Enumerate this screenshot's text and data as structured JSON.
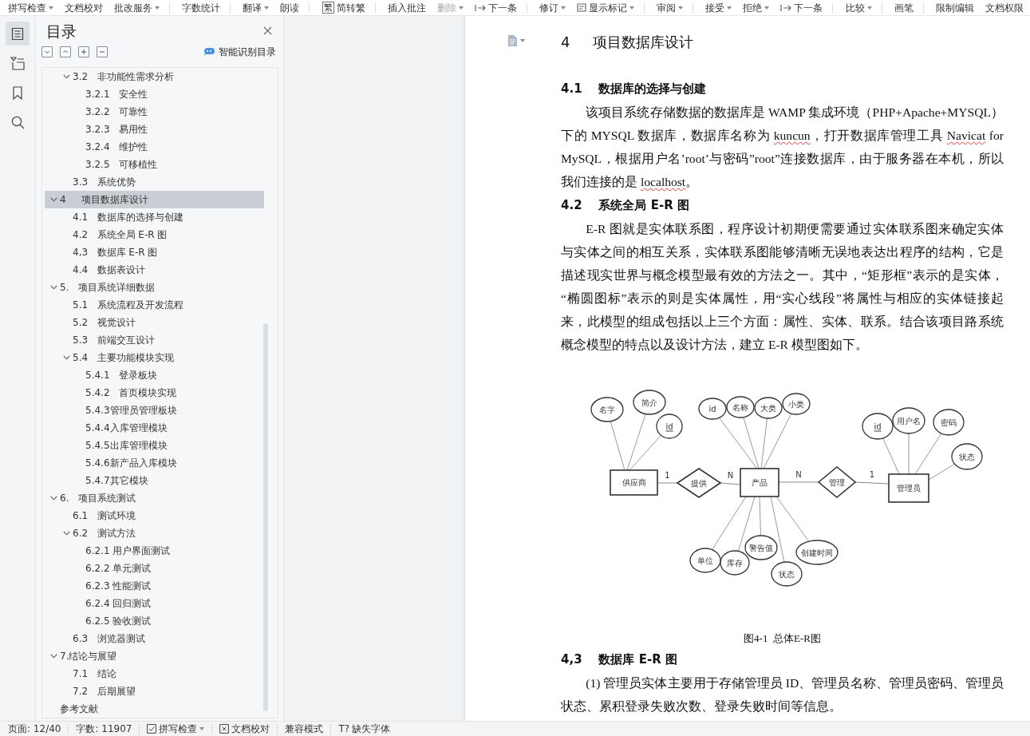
{
  "toolbar": {
    "groups": [
      [
        {
          "label": "拼写检查",
          "kind": "plain",
          "dropdown": true,
          "disabled": false
        },
        {
          "label": "文档校对",
          "kind": "plain",
          "dropdown": false,
          "disabled": false
        },
        {
          "label": "批改服务",
          "kind": "plain",
          "dropdown": true,
          "disabled": false
        }
      ],
      [
        {
          "label": "字数统计",
          "kind": "plain",
          "dropdown": false,
          "disabled": false
        }
      ],
      [
        {
          "label": "翻译",
          "kind": "plain",
          "dropdown": true,
          "disabled": false
        },
        {
          "label": "朗读",
          "kind": "plain",
          "dropdown": false,
          "disabled": false
        }
      ],
      [
        {
          "label": "简转繁",
          "kind": "glyph",
          "icon_text": "繁",
          "dropdown": false,
          "disabled": false
        }
      ],
      [
        {
          "label": "插入批注",
          "kind": "plain",
          "dropdown": false,
          "disabled": false
        },
        {
          "label": "删除",
          "kind": "plain",
          "dropdown": true,
          "disabled": true
        },
        {
          "label": "下一条",
          "kind": "next",
          "dropdown": false,
          "disabled": false
        }
      ],
      [
        {
          "label": "修订",
          "kind": "plain",
          "dropdown": true,
          "disabled": false
        },
        {
          "label": "显示标记",
          "kind": "markup",
          "dropdown": true,
          "disabled": false
        }
      ],
      [
        {
          "label": "审阅",
          "kind": "plain",
          "dropdown": true,
          "disabled": false
        }
      ],
      [
        {
          "label": "接受",
          "kind": "plain",
          "dropdown": true,
          "disabled": false
        },
        {
          "label": "拒绝",
          "kind": "plain",
          "dropdown": true,
          "disabled": false
        },
        {
          "label": "下一条",
          "kind": "next",
          "dropdown": false,
          "disabled": false
        }
      ],
      [
        {
          "label": "比较",
          "kind": "plain",
          "dropdown": true,
          "disabled": false
        }
      ],
      [
        {
          "label": "画笔",
          "kind": "plain",
          "dropdown": false,
          "disabled": false
        }
      ],
      [
        {
          "label": "限制编辑",
          "kind": "plain",
          "dropdown": false,
          "disabled": false
        },
        {
          "label": "文档权限",
          "kind": "plain",
          "dropdown": false,
          "disabled": false
        }
      ]
    ]
  },
  "rail": {
    "items": [
      {
        "kind": "contents",
        "selected": true
      },
      {
        "kind": "navigation",
        "selected": false
      },
      {
        "kind": "bookmark",
        "selected": false
      },
      {
        "kind": "search",
        "selected": false
      }
    ]
  },
  "toc": {
    "title": "目录",
    "smart_label": "智能识别目录",
    "items": [
      {
        "children": [
          {
            "label": "3.2   非功能性需求分析",
            "expanded": true,
            "selected": false,
            "children": [
              {
                "label": "3.2.1   安全性",
                "selected": false
              },
              {
                "label": "3.2.2   可靠性",
                "selected": false
              },
              {
                "label": "3.2.3   易用性",
                "selected": false
              },
              {
                "label": "3.2.4   维护性",
                "selected": false
              },
              {
                "label": "3.2.5   可移植性",
                "selected": false
              }
            ]
          },
          {
            "label": "3.3   系统优势",
            "selected": false
          }
        ]
      },
      {
        "label": "4     项目数据库设计",
        "expanded": true,
        "selected": true,
        "children": [
          {
            "label": "4.1   数据库的选择与创建",
            "selected": false
          },
          {
            "label": "4.2   系统全局 E-R 图",
            "selected": false
          },
          {
            "label": "4,3   数据库 E-R 图",
            "selected": false
          },
          {
            "label": "4.4   数据表设计",
            "selected": false
          }
        ]
      },
      {
        "label": "5.   项目系统详细数据",
        "expanded": true,
        "selected": false,
        "children": [
          {
            "label": "5.1   系统流程及开发流程",
            "selected": false
          },
          {
            "label": "5.2   视觉设计",
            "selected": false
          },
          {
            "label": "5.3   前端交互设计",
            "selected": false
          },
          {
            "label": "5.4   主要功能模块实现",
            "expanded": true,
            "selected": false,
            "children": [
              {
                "label": "5.4.1   登录板块",
                "selected": false
              },
              {
                "label": "5.4.2   首页模块实现",
                "selected": false
              },
              {
                "label": "5.4.3管理员管理板块",
                "selected": false
              },
              {
                "label": "5.4.4入库管理模块",
                "selected": false
              },
              {
                "label": "5.4.5出库管理模块",
                "selected": false
              },
              {
                "label": "5.4.6新产品入库模块",
                "selected": false
              },
              {
                "label": "5.4.7其它模块",
                "selected": false
              }
            ]
          }
        ]
      },
      {
        "label": "6.   项目系统测试",
        "expanded": true,
        "selected": false,
        "children": [
          {
            "label": "6.1   测试环境",
            "selected": false
          },
          {
            "label": "6.2   测试方法",
            "expanded": true,
            "selected": false,
            "children": [
              {
                "label": "6.2.1 用户界面测试",
                "selected": false
              },
              {
                "label": "6.2.2 单元测试",
                "selected": false
              },
              {
                "label": "6.2.3 性能测试",
                "selected": false
              },
              {
                "label": "6.2.4 回归测试",
                "selected": false
              },
              {
                "label": "6.2.5 验收测试",
                "selected": false
              }
            ]
          },
          {
            "label": "6.3   浏览器测试",
            "selected": false
          }
        ]
      },
      {
        "label": "7.结论与展望",
        "expanded": true,
        "selected": false,
        "children": [
          {
            "label": "7.1   结论",
            "selected": false
          },
          {
            "label": "7.2   后期展望",
            "selected": false
          }
        ]
      },
      {
        "label": "参考文献",
        "selected": false
      }
    ]
  },
  "document": {
    "blocks": [
      {
        "kind": "heading1",
        "text": "4     项目数据库设计"
      },
      {
        "kind": "heading2",
        "text": "4.1    数据库的选择与创建"
      },
      {
        "kind": "paragraph",
        "segments": [
          {
            "text": "该项目系统存储数据的数据库是 WAMP 集成环境（PHP+Apache+MYSQL）下的 MYSQL 数据库，数据库名称为 ",
            "spell_error": false
          },
          {
            "text": "kuncun",
            "spell_error": true
          },
          {
            "text": "，打开数据库管理工具 ",
            "spell_error": false
          },
          {
            "text": "Navicat",
            "spell_error": true
          },
          {
            "text": " for MySQL，根据用户名’root’与密码”root”连接数据库，由于服务器在本机，所以我们连接的是 ",
            "spell_error": false
          },
          {
            "text": "localhost",
            "spell_error": true
          },
          {
            "text": "。",
            "spell_error": false
          }
        ]
      },
      {
        "kind": "heading2",
        "text": "4.2    系统全局 E-R 图"
      },
      {
        "kind": "paragraph",
        "segments": [
          {
            "text": "E-R 图就是实体联系图，程序设计初期便需要通过实体联系图来确定实体与实体之间的相互关系，实体联系图能够清晰无误地表达出程序的结构，它是描述现实世界与概念模型最有效的方法之一。其中，“矩形框”表示的是实体，“椭圆图标”表示的则是实体属性，用“实心线段”将属性与相应的实体链接起来，此模型的组成包括以上三个方面：属性、实体、联系。结合该项目路系统概念模型的特点以及设计方法，建立 E-R 模型图如下。",
            "spell_error": false
          }
        ]
      },
      {
        "kind": "figure",
        "entities": [
          {
            "label": "供应商",
            "attributes": [
              {
                "label": "名字",
                "key": false
              },
              {
                "label": "简介",
                "key": false
              },
              {
                "label": "id",
                "key": true
              }
            ]
          },
          {
            "label": "产品",
            "attributes": [
              {
                "label": "id",
                "key": false
              },
              {
                "label": "名称",
                "key": false
              },
              {
                "label": "大类",
                "key": false
              },
              {
                "label": "小类",
                "key": false
              },
              {
                "label": "单位",
                "key": false
              },
              {
                "label": "库存",
                "key": false
              },
              {
                "label": "警告值",
                "key": false
              },
              {
                "label": "状态",
                "key": false
              },
              {
                "label": "创建时间",
                "key": false
              }
            ]
          },
          {
            "label": "管理员",
            "attributes": [
              {
                "label": "id",
                "key": true
              },
              {
                "label": "用户名",
                "key": false
              },
              {
                "label": "密码",
                "key": false
              },
              {
                "label": "状态",
                "key": false
              }
            ]
          }
        ],
        "relationships": [
          {
            "label": "提供",
            "left_cardinality": "1",
            "right_cardinality": "N"
          },
          {
            "label": "管理",
            "left_cardinality": "N",
            "right_cardinality": "1"
          }
        ],
        "caption": "图4-1  总体E-R图"
      },
      {
        "kind": "heading2",
        "text": "4,3    数据库 E-R 图"
      },
      {
        "kind": "paragraph",
        "segments": [
          {
            "text": "(1) 管理员实体主要用于存储管理员 ID、管理员名称、管理员密码、管理员状态、累积登录失败次数、登录失败时间等信息。",
            "spell_error": false
          }
        ]
      }
    ]
  },
  "status_bar": {
    "page": "页面: 12/40",
    "words": "字数: 11907",
    "items": [
      {
        "label": "拼写检查",
        "kind": "check",
        "dropdown": true
      },
      {
        "label": "文档校对",
        "kind": "proof",
        "dropdown": false
      },
      {
        "label": "兼容模式",
        "kind": "plain",
        "dropdown": false
      },
      {
        "label": "缺失字体",
        "kind": "glyph",
        "icon_text": "T?",
        "dropdown": false
      }
    ]
  }
}
